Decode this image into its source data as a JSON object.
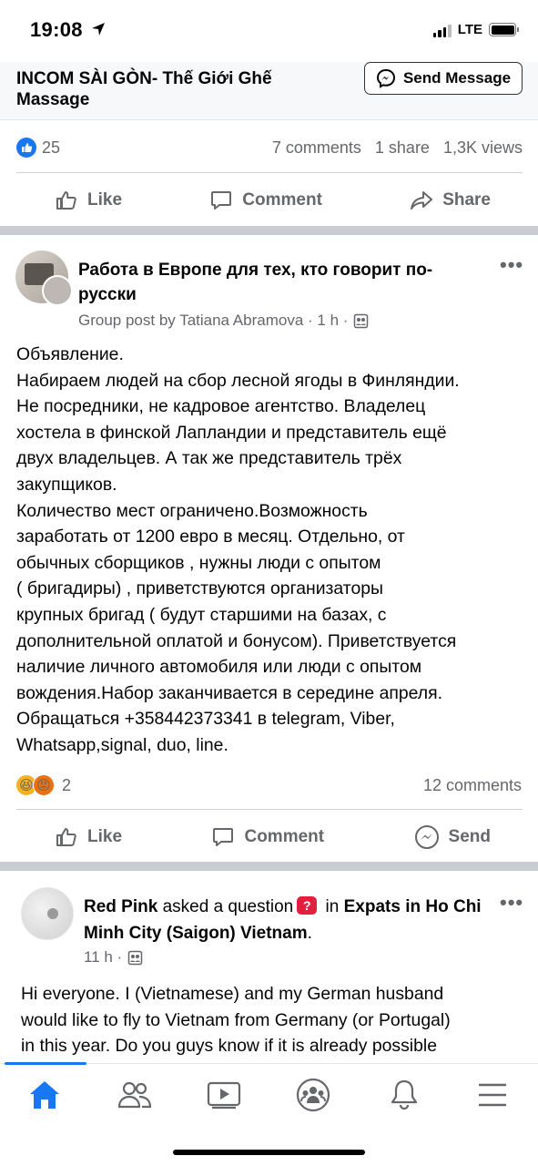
{
  "status_bar": {
    "time": "19:08",
    "network": "LTE"
  },
  "ad": {
    "page_name": "INCOM SÀI GÒN- Thế Giới Ghế Massage",
    "send_message_label": "Send Message",
    "likes": "25",
    "comments": "7 comments",
    "shares": "1 share",
    "views": "1,3K views",
    "actions": {
      "like": "Like",
      "comment": "Comment",
      "share": "Share"
    }
  },
  "post2": {
    "group_name": "Работа в Европе для тех, кто говорит по-русски",
    "meta": "Group post by Tatiana Abramova · 1 h ·",
    "body_lines": [
      "Объявление.",
      "Набираем людей на сбор лесной ягоды в Финляндии.",
      "Не посредники, не кадровое агентство. Владелец",
      "хостела в финской Лапландии и представитель ещё",
      "двух владельцев. А так же представитель трёх",
      "закупщиков.",
      "Количество мест ограничено.Возможность",
      "заработать от 1200 евро в месяц. Отдельно, от",
      "обычных сборщиков , нужны люди с опытом",
      "( бригадиры) , приветствуются организаторы",
      "крупных бригад ( будут старшими на базах, с",
      "дополнительной оплатой и бонусом). Приветствуется",
      "наличие личного автомобиля или люди с опытом",
      "вождения.Набор заканчивается в середине апреля.",
      "Обращаться +358442373341  в  telegram, Viber,",
      "Whatsapp,signal, duo, line."
    ],
    "reactions_count": "2",
    "comments": "12 comments",
    "actions": {
      "like": "Like",
      "comment": "Comment",
      "send": "Send"
    }
  },
  "post3": {
    "author": "Red Pink",
    "asked_text": "asked a question",
    "in_text": "in",
    "group": "Expats in Ho Chi Minh City (Saigon) Vietnam",
    "group_end": ".",
    "meta": "11 h ·",
    "body_lines": [
      "Hi everyone. I (Vietnamese) and my German husband",
      "would like to fly to Vietnam from Germany (or Portugal)",
      "in this year. Do you guys know if it is already possible"
    ]
  },
  "colors": {
    "brand_blue": "#1877f2",
    "secondary_text": "#65676b",
    "separator": "#c9ccd1"
  },
  "tabs": [
    "home-icon",
    "friends-icon",
    "watch-icon",
    "groups-icon",
    "notifications-icon",
    "menu-icon"
  ]
}
